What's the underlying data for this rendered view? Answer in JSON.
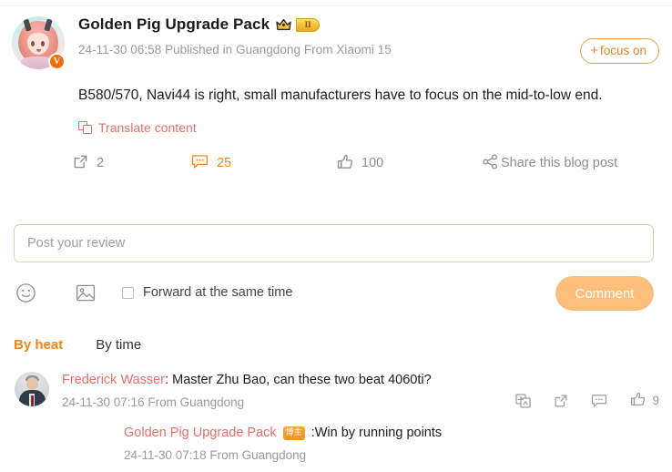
{
  "post": {
    "author": "Golden Pig Upgrade Pack",
    "level_badge": "II",
    "crown_icon": "crown-icon",
    "verified_mark": "V",
    "meta": "24-11-30 06:58 Published in Guangdong From Xiaomi 15",
    "body": "B580/570, Navi44 is right, small manufacturers have to focus on the mid-to-low end.",
    "translate_label": "Translate content",
    "follow_button": {
      "plus": "+",
      "label": "focus on"
    }
  },
  "actions": {
    "share_count": "2",
    "comment_count": "25",
    "like_count": "100",
    "blog_share_label": "Share this blog post"
  },
  "review": {
    "placeholder": "Post your review",
    "value": "",
    "forward_label": "Forward at the same time",
    "forward_checked": false,
    "submit_label": "Comment"
  },
  "sort": {
    "active_tab": "By heat",
    "inactive_tab": "By time"
  },
  "comments": [
    {
      "author": "Frederick Wasser",
      "separator": ": ",
      "text": "Master Zhu Bao, can these two beat 4060ti?",
      "time": "24-11-30 07:16 From Guangdong",
      "like_count": "9",
      "reply": {
        "author": "Golden Pig Upgrade Pack",
        "badge": "博主",
        "separator": ": ",
        "text": "Win by running points",
        "time": "24-11-30 07:18 From Guangdong"
      }
    }
  ],
  "colors": {
    "accent_orange": "#f08519",
    "link_salmon": "#e5706a",
    "muted_gray": "#9a9a9a",
    "button_orange": "#fcbe7a",
    "input_border": "#e4cfa6"
  }
}
